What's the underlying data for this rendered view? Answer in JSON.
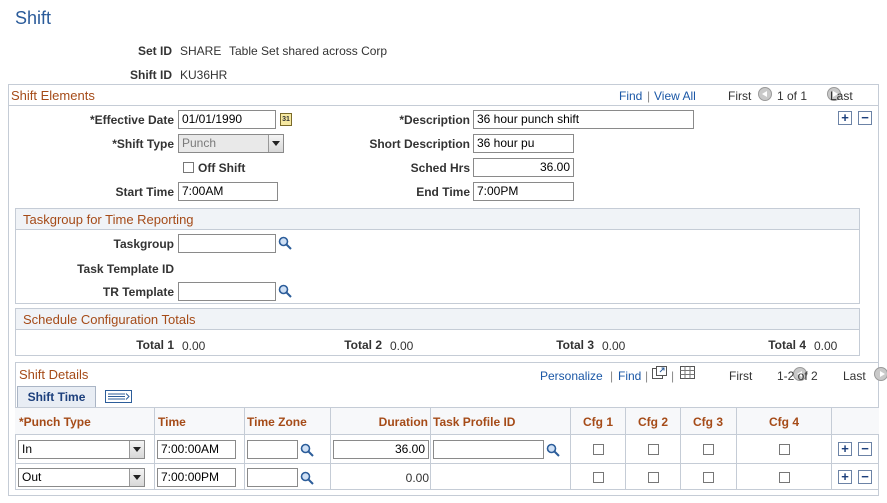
{
  "page": {
    "title": "Shift"
  },
  "header": {
    "set_id_label": "Set ID",
    "set_id_value": "SHARE",
    "set_id_desc": "Table Set shared across Corp",
    "shift_id_label": "Shift ID",
    "shift_id_value": "KU36HR"
  },
  "shift_elements": {
    "title": "Shift Elements",
    "find": "Find",
    "view_all": "View All",
    "first": "First",
    "counter": "1 of 1",
    "last": "Last",
    "effective_date_label": "*Effective Date",
    "effective_date_value": "01/01/1990",
    "description_label": "*Description",
    "description_value": "36 hour punch shift",
    "shift_type_label": "*Shift Type",
    "shift_type_value": "Punch",
    "short_description_label": "Short Description",
    "short_description_value": "36 hour pu",
    "off_shift_label": "Off Shift",
    "sched_hrs_label": "Sched Hrs",
    "sched_hrs_value": "36.00",
    "start_time_label": "Start Time",
    "start_time_value": "7:00AM",
    "end_time_label": "End Time",
    "end_time_value": "7:00PM"
  },
  "taskgroup": {
    "title": "Taskgroup for Time Reporting",
    "taskgroup_label": "Taskgroup",
    "taskgroup_value": "",
    "task_template_label": "Task Template ID",
    "tr_template_label": "TR Template",
    "tr_template_value": ""
  },
  "totals": {
    "title": "Schedule Configuration Totals",
    "items": [
      {
        "label": "Total 1",
        "value": "0.00"
      },
      {
        "label": "Total 2",
        "value": "0.00"
      },
      {
        "label": "Total 3",
        "value": "0.00"
      },
      {
        "label": "Total 4",
        "value": "0.00"
      }
    ]
  },
  "shift_details": {
    "title": "Shift Details",
    "personalize": "Personalize",
    "find": "Find",
    "first": "First",
    "counter": "1-2 of 2",
    "last": "Last",
    "tab": "Shift Time",
    "columns": [
      "*Punch Type",
      "Time",
      "Time Zone",
      "Duration",
      "Task Profile ID",
      "Cfg 1",
      "Cfg 2",
      "Cfg 3",
      "Cfg 4"
    ],
    "rows": [
      {
        "punch_type": "In",
        "time": "7:00:00AM",
        "time_zone": "",
        "duration": "36.00",
        "task_profile": ""
      },
      {
        "punch_type": "Out",
        "time": "7:00:00PM",
        "time_zone": "",
        "duration": "0.00",
        "task_profile": ""
      }
    ]
  },
  "colors": {
    "accent": "#a54b18",
    "link": "#1a57a6",
    "title": "#2a5b9a",
    "border": "#c5ccd6"
  },
  "icons": [
    "calendar-icon",
    "lookup-magnifier-icon",
    "add-row-icon",
    "delete-row-icon",
    "previous-icon",
    "next-icon",
    "new-window-icon",
    "grid-view-icon"
  ]
}
